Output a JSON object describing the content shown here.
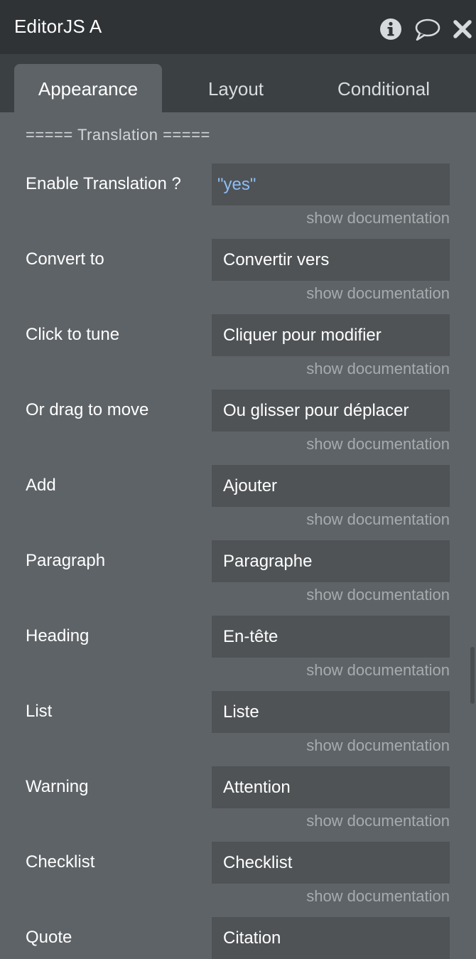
{
  "window": {
    "title": "EditorJS A",
    "icons": [
      "info-icon",
      "comment-icon",
      "close-icon"
    ]
  },
  "tabs": [
    {
      "label": "Appearance",
      "active": true
    },
    {
      "label": "Layout",
      "active": false
    },
    {
      "label": "Conditional",
      "active": false
    }
  ],
  "section": {
    "header": "===== Translation ====="
  },
  "fields": [
    {
      "label": "Enable Translation ?",
      "value": "\"yes\"",
      "dynamic": true,
      "doc": "show documentation"
    },
    {
      "label": "Convert to",
      "value": "Convertir vers",
      "doc": "show documentation"
    },
    {
      "label": "Click to tune",
      "value": "Cliquer pour modifier",
      "doc": "show documentation"
    },
    {
      "label": "Or drag to move",
      "value": "Ou glisser pour déplacer",
      "doc": "show documentation"
    },
    {
      "label": "Add",
      "value": "Ajouter",
      "doc": "show documentation"
    },
    {
      "label": "Paragraph",
      "value": "Paragraphe",
      "doc": "show documentation"
    },
    {
      "label": "Heading",
      "value": "En-tête",
      "doc": "show documentation"
    },
    {
      "label": "List",
      "value": "Liste",
      "doc": "show documentation"
    },
    {
      "label": "Warning",
      "value": "Attention",
      "doc": "show documentation"
    },
    {
      "label": "Checklist",
      "value": "Checklist",
      "doc": "show documentation"
    },
    {
      "label": "Quote",
      "value": "Citation",
      "doc": ""
    }
  ],
  "colors": {
    "titlebar": "#2f3336",
    "tabbar": "#3b4043",
    "panel": "#5e6367",
    "input": "#4f5356",
    "dynamic_value": "#8cbdf6",
    "doc_link": "#a6abae"
  }
}
